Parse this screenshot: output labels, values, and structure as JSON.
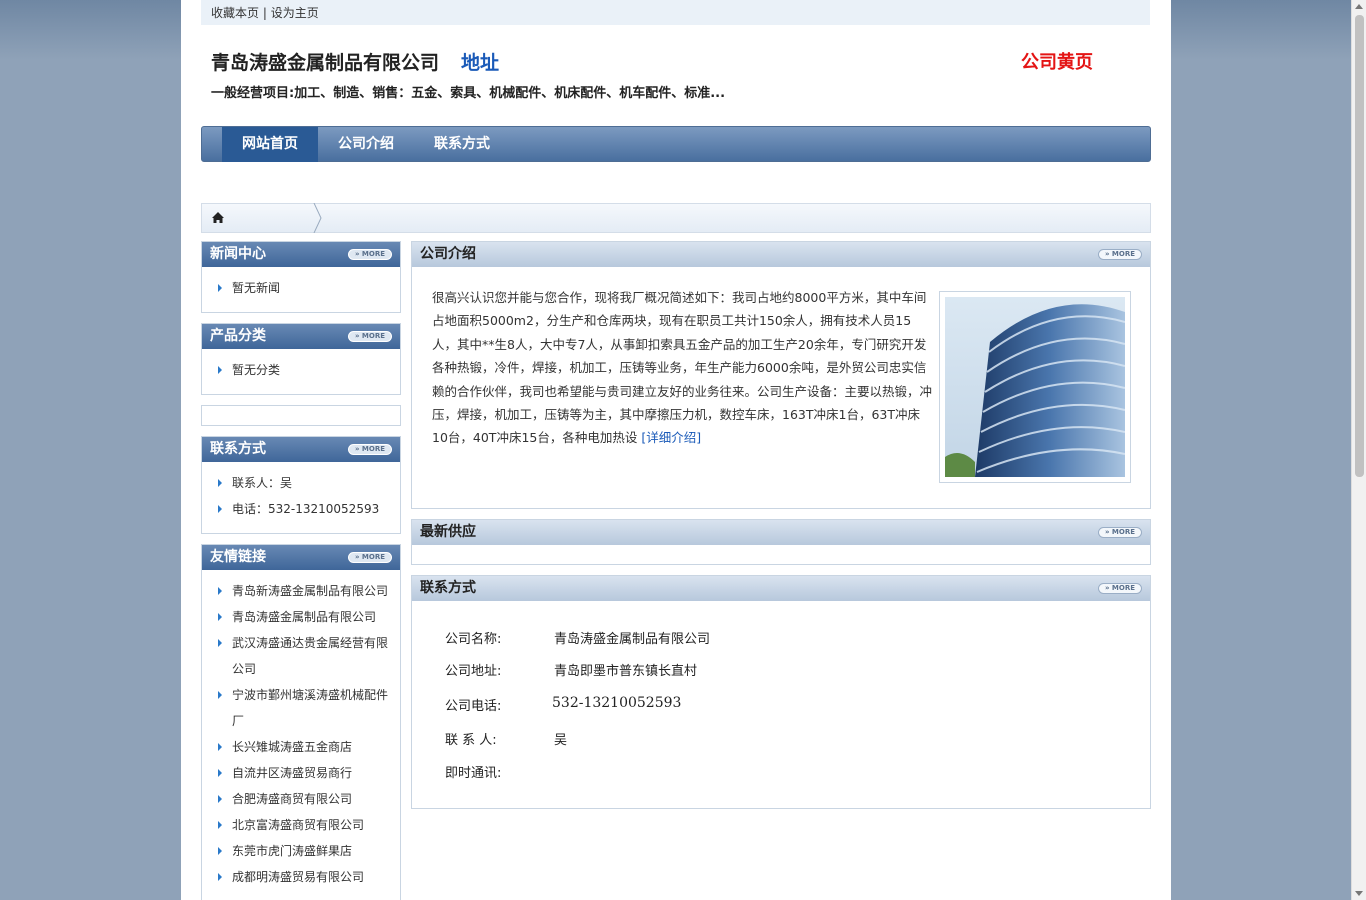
{
  "topbar": {
    "bookmark": "收藏本页",
    "separator": "|",
    "set_home": "设为主页"
  },
  "header": {
    "company_name": "青岛涛盛金属制品有限公司",
    "address_link": "地址",
    "yellow_pages": "公司黄页",
    "business": "一般经营项目:加工、制造、销售：五金、索具、机械配件、机床配件、机车配件、标准..."
  },
  "nav": {
    "tabs": [
      {
        "label": "网站首页"
      },
      {
        "label": "公司介绍"
      },
      {
        "label": "联系方式"
      }
    ]
  },
  "sidebar": {
    "more_label": "» MORE",
    "news": {
      "title": "新闻中心",
      "items": [
        "暂无新闻"
      ]
    },
    "products": {
      "title": "产品分类",
      "items": [
        "暂无分类"
      ]
    },
    "contact": {
      "title": "联系方式",
      "items": [
        "联系人：吴",
        "电话：532-13210052593"
      ]
    },
    "links": {
      "title": "友情链接",
      "items": [
        "青岛新涛盛金属制品有限公司",
        "青岛涛盛金属制品有限公司",
        "武汉涛盛通达贵金属经营有限公司",
        "宁波市鄞州塘溪涛盛机械配件厂",
        "长兴雉城涛盛五金商店",
        "自流井区涛盛贸易商行",
        "合肥涛盛商贸有限公司",
        "北京富涛盛商贸有限公司",
        "东莞市虎门涛盛鲜果店",
        "成都明涛盛贸易有限公司"
      ]
    }
  },
  "main": {
    "intro": {
      "title": "公司介绍",
      "text": "很高兴认识您并能与您合作，现将我厂概况简述如下：我司占地约8000平方米，其中车间占地面积5000m2，分生产和仓库两块，现有在职员工共计150余人，拥有技术人员15人，其中**生8人，大中专7人，从事卸扣索具五金产品的加工生产20余年，专门研究开发各种热锻，冷件，焊接，机加工，压铸等业务，年生产能力6000余吨，是外贸公司忠实信赖的合作伙伴，我司也希望能与贵司建立友好的业务往来。公司生产设备：主要以热锻，冲压，焊接，机加工，压铸等为主，其中摩擦压力机，数控车床，163T冲床1台，63T冲床10台，40T冲床15台，各种电加热设",
      "detail_link": "[详细介绍]"
    },
    "supply": {
      "title": "最新供应"
    },
    "contact": {
      "title": "联系方式",
      "rows": [
        {
          "k": "公司名称:",
          "v": "青岛涛盛金属制品有限公司"
        },
        {
          "k": "公司地址:",
          "v": "青岛即墨市普东镇长直村"
        },
        {
          "k": "公司电话:",
          "v": "532-13210052593"
        },
        {
          "k": "联 系 人:",
          "v": "吴"
        },
        {
          "k": "即时通讯:",
          "v": ""
        }
      ]
    }
  },
  "icons": {
    "home": "home-icon",
    "breadcrumb_arrow": "chevron-right-icon",
    "bullet": "triangle-right-icon"
  },
  "colors": {
    "nav_active": "#2a5a95",
    "header_blue": "#3f6699",
    "link_blue": "#1a5ab8",
    "accent_red": "#e41414"
  }
}
